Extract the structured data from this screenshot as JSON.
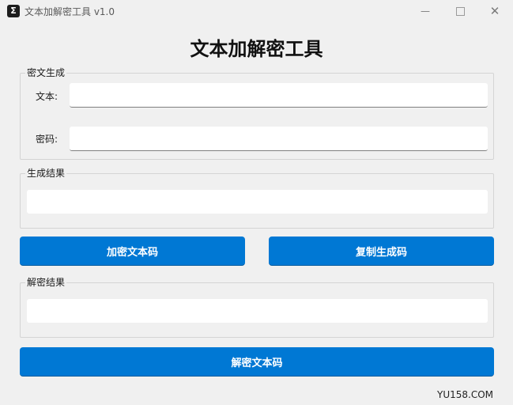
{
  "window": {
    "icon_glyph": "Σ",
    "title": "文本加解密工具 v1.0",
    "close_glyph": "✕",
    "minimize_glyph": "—"
  },
  "header": {
    "title": "文本加解密工具"
  },
  "cipher_group": {
    "label": "密文生成",
    "text_label": "文本:",
    "text_value": "",
    "password_label": "密码:",
    "password_value": ""
  },
  "result_group": {
    "label": "生成结果",
    "value": ""
  },
  "buttons": {
    "encrypt_label": "加密文本码",
    "copy_label": "复制生成码",
    "decrypt_label": "解密文本码"
  },
  "decrypt_group": {
    "label": "解密结果",
    "value": ""
  },
  "footer": {
    "watermark": "YU158.COM"
  },
  "colors": {
    "accent": "#0078d4",
    "background": "#f0f0f0"
  },
  "icons": [
    "app-icon",
    "minimize-icon",
    "maximize-icon",
    "close-icon"
  ]
}
